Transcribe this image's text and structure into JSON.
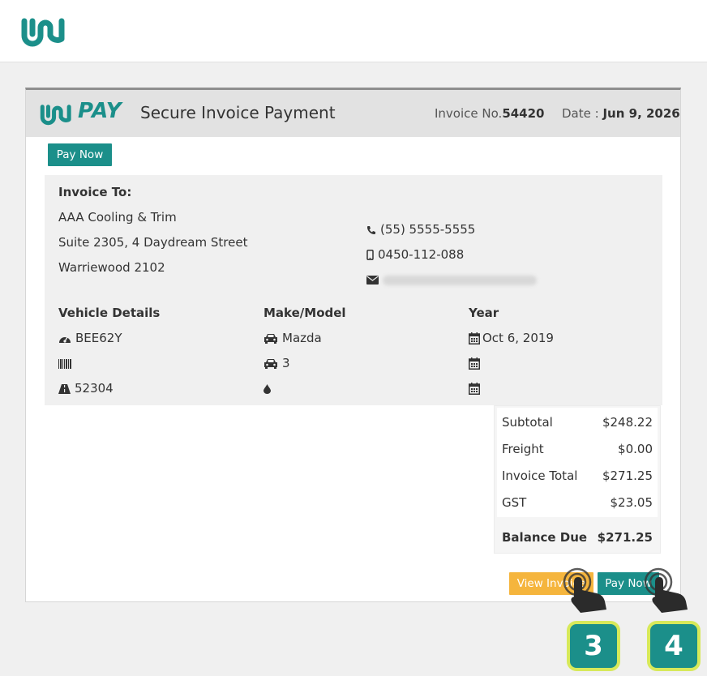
{
  "app": {
    "logo_icon": "brand-logo-icon",
    "brand_color": "#1b8f8a"
  },
  "header": {
    "pay_label": "PAY",
    "title": "Secure Invoice Payment",
    "invoice_no_label": "Invoice No.",
    "invoice_no": "54420",
    "date_label": "Date :",
    "date": "Jun 9, 2026"
  },
  "top_pay_button": "Pay Now",
  "invoice_to": {
    "heading": "Invoice To:",
    "name": "AAA Cooling & Trim",
    "address1": "Suite 2305, 4 Daydream Street",
    "address2": "Warriewood 2102",
    "phone": "(55) 5555-5555",
    "mobile": "0450-112-088",
    "email_redacted": ""
  },
  "vehicle": {
    "heading": "Vehicle Details",
    "rego": "BEE62Y",
    "vin": "",
    "odometer": "52304"
  },
  "make_model": {
    "heading": "Make/Model",
    "make": "Mazda",
    "model": "3",
    "fuel": ""
  },
  "year": {
    "heading": "Year",
    "date1": "Oct 6, 2019",
    "date2": "",
    "date3": ""
  },
  "totals": {
    "subtotal_label": "Subtotal",
    "subtotal": "$248.22",
    "freight_label": "Freight",
    "freight": "$0.00",
    "invoice_total_label": "Invoice Total",
    "invoice_total": "$271.25",
    "gst_label": "GST",
    "gst": "$23.05",
    "balance_label": "Balance Due",
    "balance": "$271.25"
  },
  "actions": {
    "view_invoice": "View Invoice",
    "pay_now": "Pay Now"
  },
  "annotations": {
    "step_a": "3",
    "step_b": "4"
  }
}
